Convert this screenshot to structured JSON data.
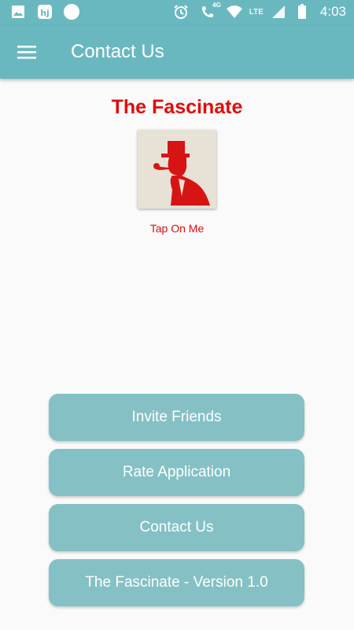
{
  "status_bar": {
    "time": "4:03",
    "network_label": "4G",
    "lte_label": "LTE",
    "left_icons": [
      "image-icon",
      "hj-app-icon",
      "circle-icon"
    ],
    "right_icons": [
      "alarm-icon",
      "call-icon",
      "wifi-icon",
      "signal-icon",
      "battery-icon"
    ],
    "hj_label": "hj"
  },
  "app_bar": {
    "title": "Contact Us",
    "menu_icon": "hamburger-menu-icon",
    "color": "#6ab8bf"
  },
  "main": {
    "brand_title": "The Fascinate",
    "logo_icon": "gentleman-silhouette-logo",
    "tap_label": "Tap On Me",
    "accent_color": "#e10b0b"
  },
  "buttons": [
    {
      "label": "Invite Friends"
    },
    {
      "label": "Rate Application"
    },
    {
      "label": "Contact Us"
    },
    {
      "label": "The Fascinate - Version 1.0"
    }
  ],
  "button_color": "#85c1c4"
}
